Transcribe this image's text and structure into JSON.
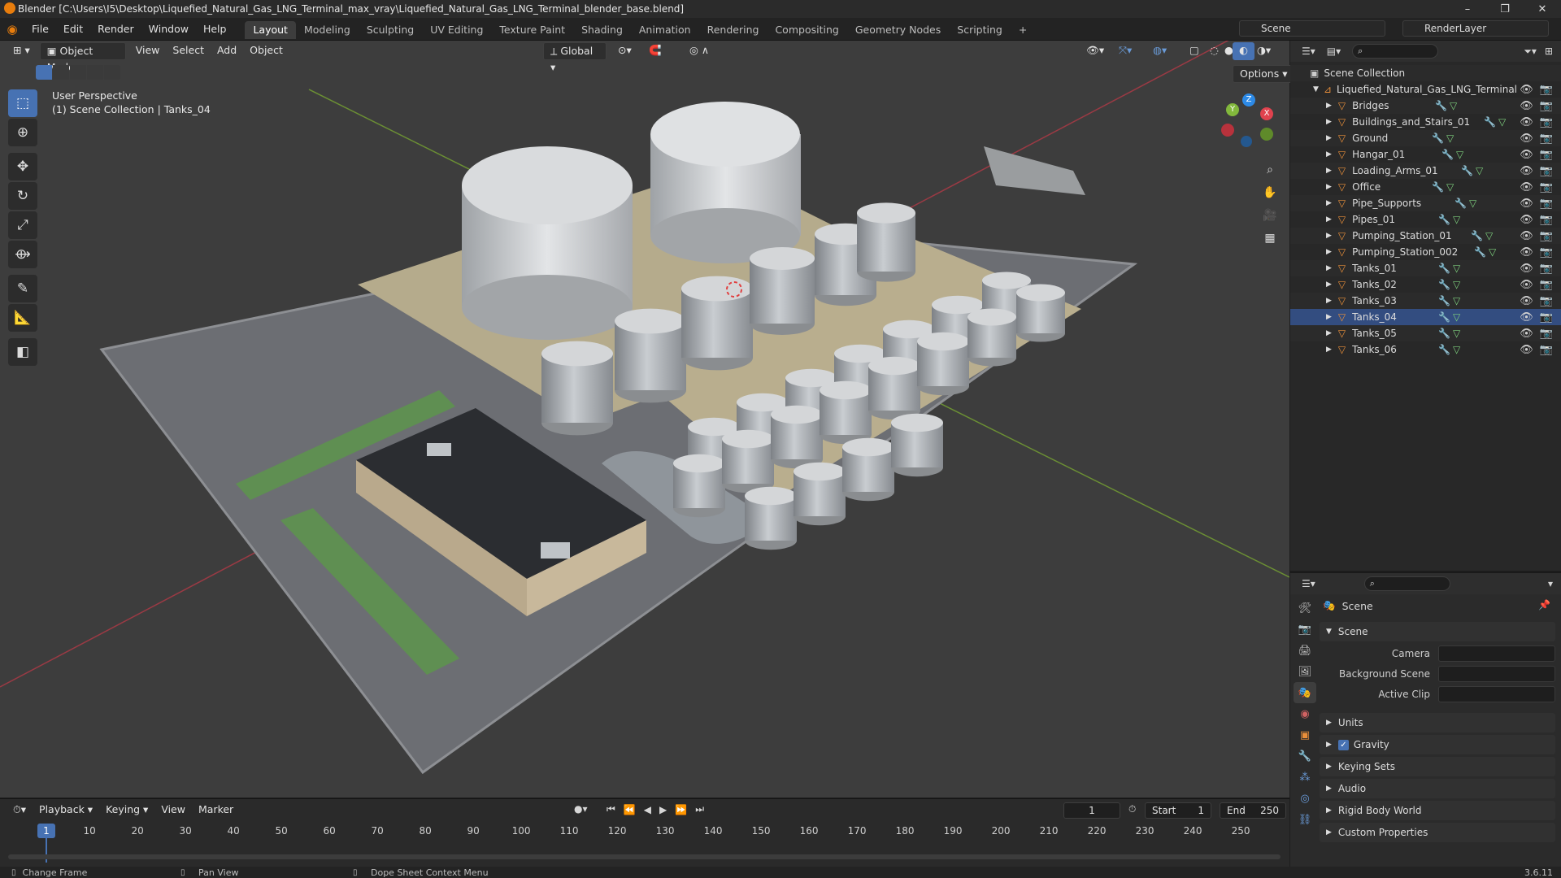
{
  "window": {
    "title": "Blender [C:\\Users\\I5\\Desktop\\Liquefied_Natural_Gas_LNG_Terminal_max_vray\\Liquefied_Natural_Gas_LNG_Terminal_blender_base.blend]",
    "minimize": "–",
    "maximize": "❐",
    "close": "✕"
  },
  "menu": [
    "File",
    "Edit",
    "Render",
    "Window",
    "Help"
  ],
  "workspaces": [
    "Layout",
    "Modeling",
    "Sculpting",
    "UV Editing",
    "Texture Paint",
    "Shading",
    "Animation",
    "Rendering",
    "Compositing",
    "Geometry Nodes",
    "Scripting",
    "+"
  ],
  "scene_selector": "Scene",
  "layer_selector": "RenderLayer",
  "viewport": {
    "mode": "Object Mode",
    "menus": [
      "View",
      "Select",
      "Add",
      "Object"
    ],
    "orientation": "Global",
    "options": "Options",
    "overlay_title": "User Perspective",
    "overlay_subtitle": "(1) Scene Collection | Tanks_04",
    "gizmo_axes": {
      "x": "X",
      "y": "Y",
      "z": "Z"
    }
  },
  "outliner": {
    "root": "Scene Collection",
    "collection": "Liquefied_Natural_Gas_LNG_Terminal",
    "items": [
      "Bridges",
      "Buildings_and_Stairs_01",
      "Ground",
      "Hangar_01",
      "Loading_Arms_01",
      "Office",
      "Pipe_Supports",
      "Pipes_01",
      "Pumping_Station_01",
      "Pumping_Station_002",
      "Tanks_01",
      "Tanks_02",
      "Tanks_03",
      "Tanks_04",
      "Tanks_05",
      "Tanks_06"
    ],
    "active_item": "Tanks_04"
  },
  "properties": {
    "context": "Scene",
    "panel_open": "Scene",
    "fields": {
      "camera": "Camera",
      "background_scene": "Background Scene",
      "active_clip": "Active Clip"
    },
    "collapsed_panels": [
      "Units",
      "Gravity",
      "Keying Sets",
      "Audio",
      "Rigid Body World",
      "Custom Properties"
    ],
    "gravity_checked": true
  },
  "timeline": {
    "menus": [
      "Playback",
      "Keying",
      "View",
      "Marker"
    ],
    "current_frame": "1",
    "start_label": "Start",
    "start": "1",
    "end_label": "End",
    "end": "250",
    "ruler": [
      "1",
      "10",
      "20",
      "30",
      "40",
      "50",
      "60",
      "70",
      "80",
      "90",
      "100",
      "110",
      "120",
      "130",
      "140",
      "150",
      "160",
      "170",
      "180",
      "190",
      "200",
      "210",
      "220",
      "230",
      "240",
      "250"
    ]
  },
  "statusbar": {
    "left": "Change Frame",
    "middle": "Pan View",
    "right": "Dope Sheet Context Menu",
    "version": "3.6.11"
  },
  "colors": {
    "accent": "#4772b3",
    "x_axis": "#e0424e",
    "y_axis": "#82b83c",
    "z_axis": "#2d8ae6",
    "object_orange": "#e98f3a"
  }
}
